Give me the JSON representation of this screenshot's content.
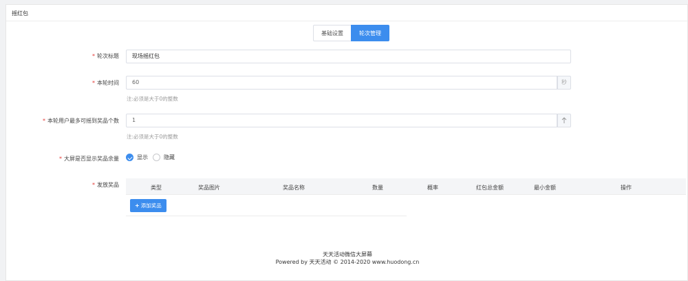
{
  "panel": {
    "title": "摇红包"
  },
  "tabs": [
    {
      "label": "基础设置",
      "active": false
    },
    {
      "label": "轮次管理",
      "active": true
    }
  ],
  "form": {
    "round_title": {
      "label": "轮次标题",
      "value": "现场摇红包"
    },
    "duration": {
      "label": "本轮时间",
      "value": "60",
      "unit": "秒",
      "hint": "注:必须是大于0的整数"
    },
    "max_prizes": {
      "label": "本轮用户最多可摇到奖品个数",
      "value": "1",
      "hint": "注:必须是大于0的整数"
    },
    "show_remaining": {
      "label": "大屏是否显示奖品余量",
      "options": [
        {
          "label": "显示",
          "checked": true
        },
        {
          "label": "隐藏",
          "checked": false
        }
      ]
    },
    "prizes": {
      "label": "发放奖品",
      "columns": [
        "类型",
        "奖品图片",
        "奖品名称",
        "数量",
        "概率",
        "红包总金额",
        "最小金额",
        "操作"
      ],
      "add_button": "添加奖品"
    }
  },
  "footer": {
    "line1": "天天活动微信大屏幕",
    "line2": "Powered by 天天活动 © 2014-2020 www.huodong.cn"
  },
  "colors": {
    "primary": "#3c8dee",
    "required": "#e53935"
  }
}
